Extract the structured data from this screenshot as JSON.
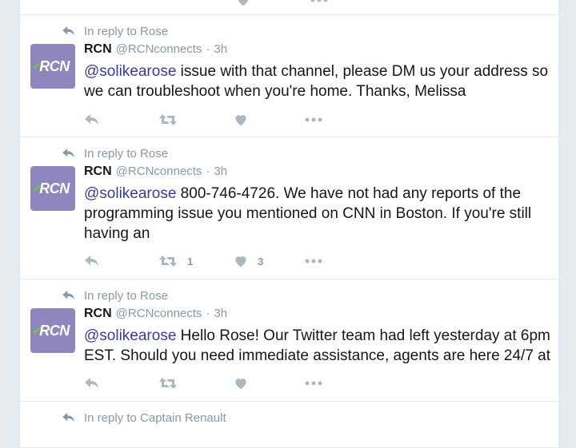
{
  "tweets": [
    {
      "reply_context": "In reply to Rose",
      "name": "RCN",
      "handle": "@RCNconnects",
      "separator": "·",
      "time": "3h",
      "mention": "@solikearose",
      "text": " issue with that channel, please DM us your address so we can troubleshoot when you're home. Thanks, Melissa",
      "retweet_count": "",
      "like_count": ""
    },
    {
      "reply_context": "In reply to Rose",
      "name": "RCN",
      "handle": "@RCNconnects",
      "separator": "·",
      "time": "3h",
      "mention": "@solikearose",
      "text": " 800-746-4726. We have not had any reports of the programming issue you mentioned on CNN in Boston. If you're still having an",
      "retweet_count": "1",
      "like_count": "3"
    },
    {
      "reply_context": "In reply to Rose",
      "name": "RCN",
      "handle": "@RCNconnects",
      "separator": "·",
      "time": "3h",
      "mention": "@solikearose",
      "text": " Hello Rose! Our Twitter team had left yesterday at 6pm EST. Should you need immediate assistance, agents are here 24/7 at",
      "retweet_count": "",
      "like_count": ""
    },
    {
      "reply_context": "In reply to Captain Renault"
    }
  ],
  "avatar_logo": "RCN",
  "colors": {
    "background": "#e6ecf0",
    "avatar": "#8f86be",
    "mention": "#3b3b98",
    "muted": "#8899a6"
  },
  "icons": [
    "reply-icon",
    "retweet-icon",
    "like-icon",
    "more-icon"
  ]
}
